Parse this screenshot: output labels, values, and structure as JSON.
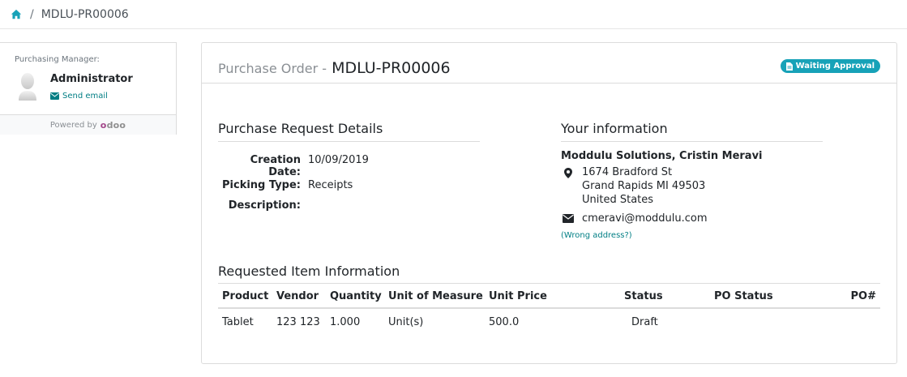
{
  "breadcrumb": {
    "separator": "/",
    "current": "MDLU-PR00006"
  },
  "sidebar": {
    "role_label": "Purchasing Manager:",
    "manager_name": "Administrator",
    "send_email": "Send email",
    "powered_by": "Powered by",
    "brand": {
      "first": "o",
      "rest": "doo"
    }
  },
  "order": {
    "title_prefix": "Purchase Order -",
    "title_name": "MDLU-PR00006",
    "status_badge": "Waiting Approval"
  },
  "request_details": {
    "heading": "Purchase Request Details",
    "creation_date_label": "Creation Date:",
    "creation_date": "10/09/2019",
    "picking_type_label": "Picking Type:",
    "picking_type": "Receipts",
    "description_label": "Description:"
  },
  "your_info": {
    "heading": "Your information",
    "company_contact": "Moddulu Solutions, Cristin Meravi",
    "address_line1": "1674 Bradford St",
    "address_line2": "Grand Rapids MI 49503",
    "address_line3": "United States",
    "email": "cmeravi@moddulu.com",
    "wrong_address": "(Wrong address?)"
  },
  "items": {
    "heading": "Requested Item Information",
    "columns": [
      "Product",
      "Vendor",
      "Quantity",
      "Unit of Measure",
      "Unit Price",
      "Status",
      "PO Status",
      "PO#"
    ],
    "rows": [
      {
        "product": "Tablet",
        "vendor": "123 123",
        "quantity": "1.000",
        "uom": "Unit(s)",
        "unit_price": "500.0",
        "status": "Draft",
        "po_status": "",
        "po_number": ""
      }
    ]
  },
  "colors": {
    "accent": "#017e84",
    "badge": "#17a2b8",
    "brand": "#a24689"
  },
  "icons": [
    "home-icon",
    "envelope-icon",
    "avatar-icon",
    "document-icon",
    "map-marker-icon"
  ]
}
